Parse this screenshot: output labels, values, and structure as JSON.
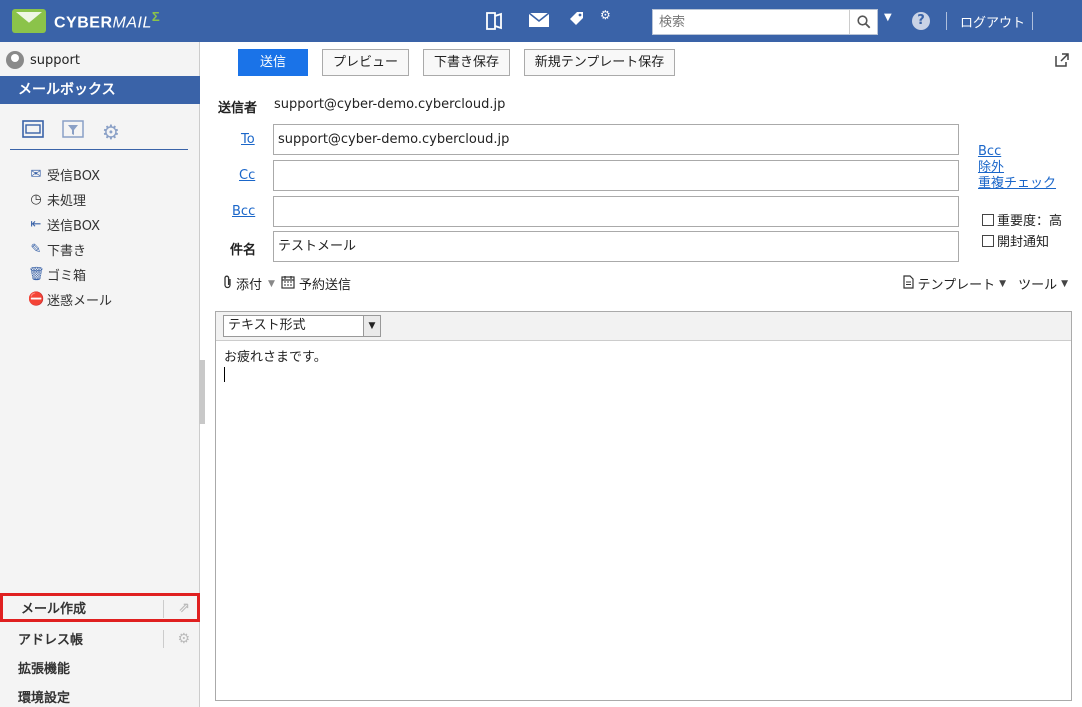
{
  "app": {
    "logo_text": "CYBER",
    "logo_mail": "MAIL",
    "logo_sigma": "Σ"
  },
  "header": {
    "search_placeholder": "検索",
    "logout_label": "ログアウト",
    "help_label": "?"
  },
  "sidebar": {
    "username": "support",
    "mailbox_title": "メールボックス",
    "folders": [
      {
        "label": "受信BOX",
        "icon": "inbox-icon"
      },
      {
        "label": "未処理",
        "icon": "clock-icon"
      },
      {
        "label": "送信BOX",
        "icon": "outbox-icon"
      },
      {
        "label": "下書き",
        "icon": "draft-icon"
      },
      {
        "label": "ゴミ箱",
        "icon": "trash-icon"
      },
      {
        "label": "迷惑メール",
        "icon": "spam-icon"
      }
    ],
    "bottom_items": {
      "compose": "メール作成",
      "address_book": "アドレス帳",
      "extensions": "拡張機能",
      "settings": "環境設定"
    }
  },
  "toolbar": {
    "send": "送信",
    "preview": "プレビュー",
    "save_draft": "下書き保存",
    "save_template": "新規テンプレート保存"
  },
  "compose": {
    "from_label": "送信者",
    "from_value": "support@cyber-demo.cybercloud.jp",
    "to_label": "To",
    "to_value": "support@cyber-demo.cybercloud.jp",
    "cc_label": "Cc",
    "cc_value": "",
    "bcc_label": "Bcc",
    "bcc_value": "",
    "subject_label": "件名",
    "subject_value": "テストメール",
    "right_links": [
      "Bcc",
      "除外",
      "重複チェック"
    ],
    "importance_label": "重要度：高",
    "read_receipt_label": "開封通知",
    "attach_label": "添付",
    "schedule_label": "予約送信",
    "template_label": "テンプレート",
    "tools_label": "ツール",
    "format_value": "テキスト形式",
    "body_text": "お疲れさまです。"
  }
}
